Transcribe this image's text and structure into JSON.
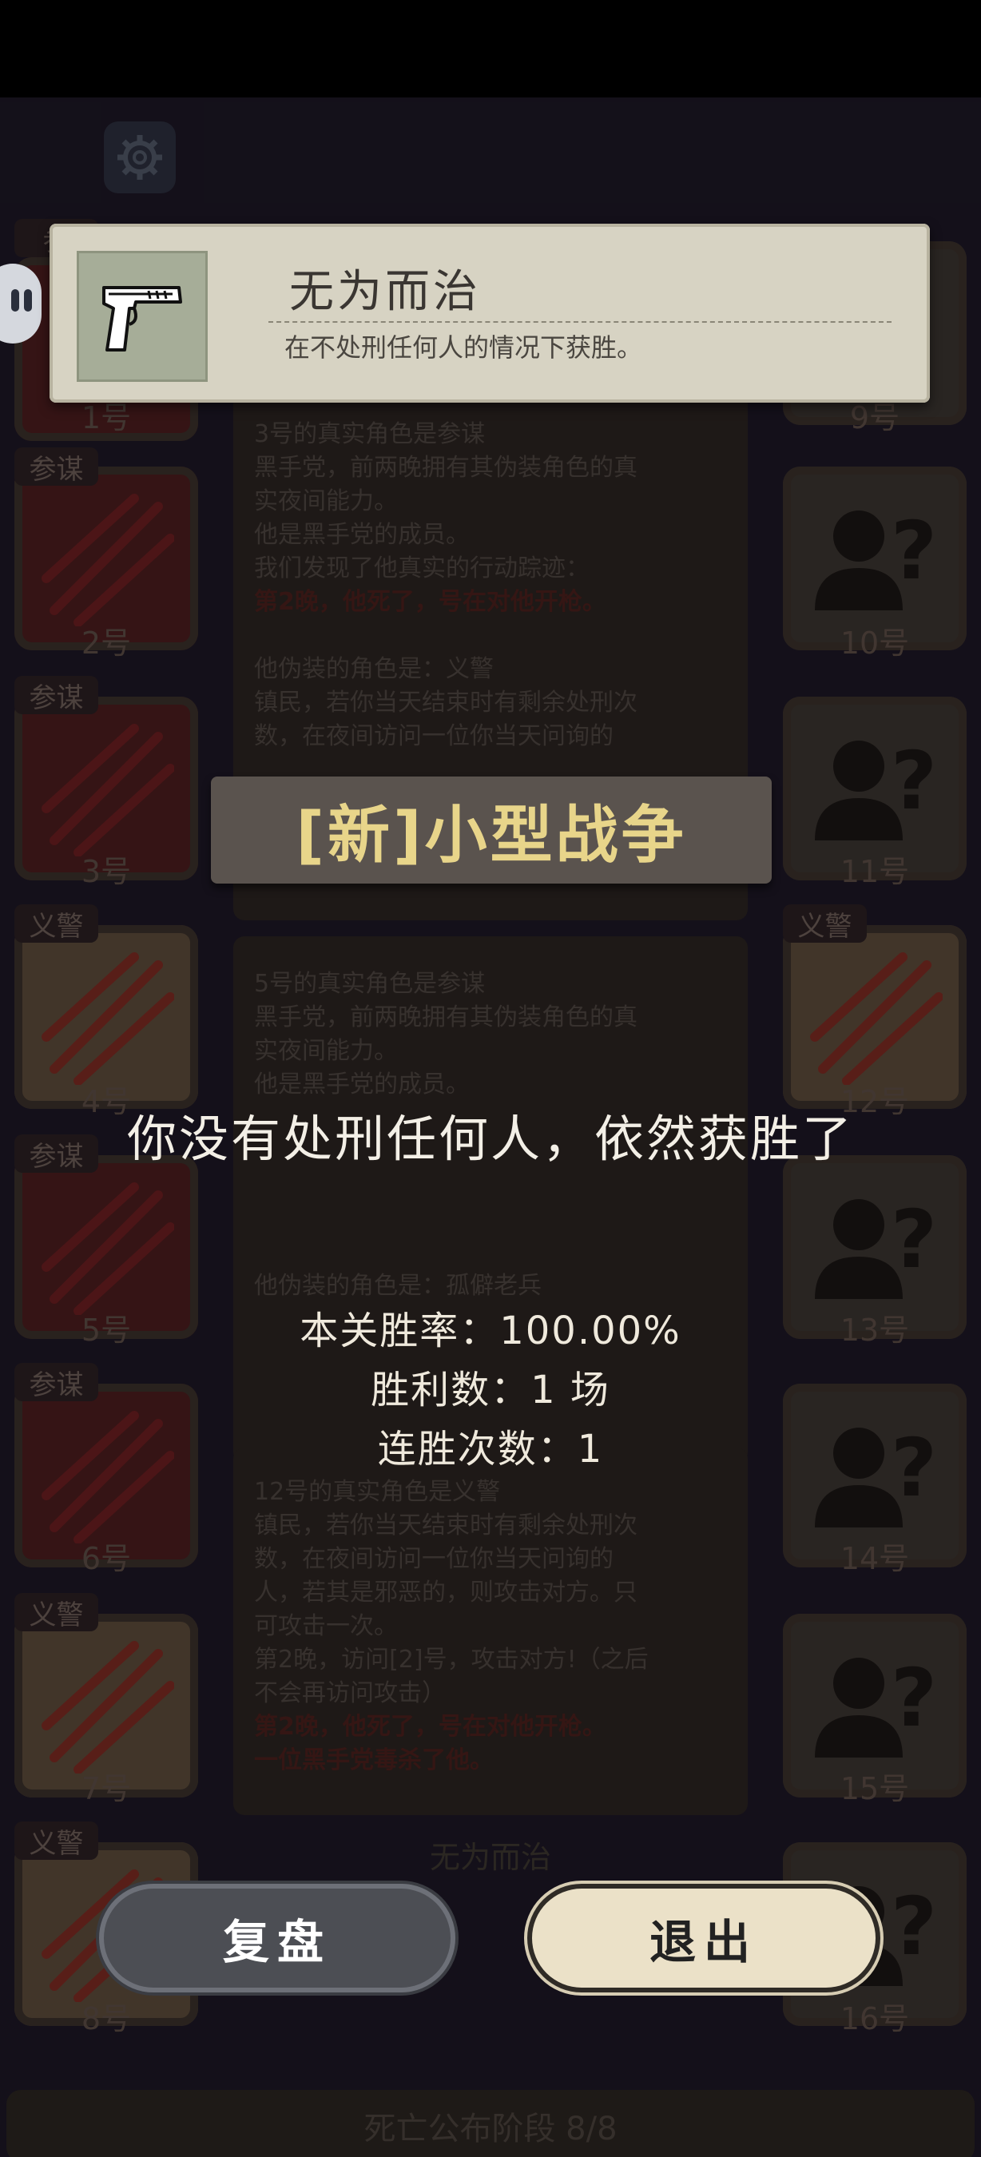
{
  "achievement": {
    "title": "无为而治",
    "description": "在不处刑任何人的情况下获胜。",
    "icon": "pistol-icon"
  },
  "level": {
    "title": "[新]小型战争"
  },
  "result": {
    "message": "你没有处刑任何人，依然获胜了",
    "win_rate": "本关胜率：100.00%",
    "wins": "胜利数：1 场",
    "streak": "连胜次数：1"
  },
  "buttons": {
    "replay": "复盘",
    "exit": "退出"
  },
  "board": {
    "left_slots": [
      {
        "number": "1号",
        "role": "参"
      },
      {
        "number": "2号",
        "role": "参谋"
      },
      {
        "number": "3号",
        "role": "参谋"
      },
      {
        "number": "4号",
        "role": "义警"
      },
      {
        "number": "5号",
        "role": "参谋"
      },
      {
        "number": "6号",
        "role": "参谋"
      },
      {
        "number": "7号",
        "role": "义警"
      },
      {
        "number": "8号",
        "role": "义警"
      }
    ],
    "right_slots": [
      {
        "number": "9号",
        "role": ""
      },
      {
        "number": "10号",
        "role": ""
      },
      {
        "number": "11号",
        "role": ""
      },
      {
        "number": "12号",
        "role": "义警"
      },
      {
        "number": "13号",
        "role": ""
      },
      {
        "number": "14号",
        "role": ""
      },
      {
        "number": "15号",
        "role": ""
      },
      {
        "number": "16号",
        "role": ""
      }
    ],
    "log": [
      "3号的真实角色是参谋",
      "黑手党，前两晚拥有其伪装角色的真",
      "实夜间能力。",
      "他是黑手党的成员。",
      "我们发现了他真实的行动踪迹：",
      "第2晚，他死了，号在对他开枪。",
      "他伪装的角色是：义警",
      "镇民，若你当天结束时有剩余处刑次",
      "数，在夜间访问一位你当天问询的",
      "5号的真实角色是参谋",
      "黑手党，前两晚拥有其伪装角色的真",
      "实夜间能力。",
      "他是黑手党的成员。",
      "他伪装的角色是：孤僻老兵",
      "12号的真实角色是义警",
      "镇民，若你当天结束时有剩余处刑次",
      "数，在夜间访问一位你当天问询的",
      "人，若其是邪恶的，则攻击对方。只",
      "可攻击一次。",
      "第2晚，访问[2]号，攻击对方!（之后",
      "不会再访问攻击）",
      "第2晚，他死了，号在对他开枪。",
      "一位黑手党毒杀了他。"
    ],
    "bottom_title": "无为而治",
    "phase": "死亡公布阶段 8/8"
  }
}
